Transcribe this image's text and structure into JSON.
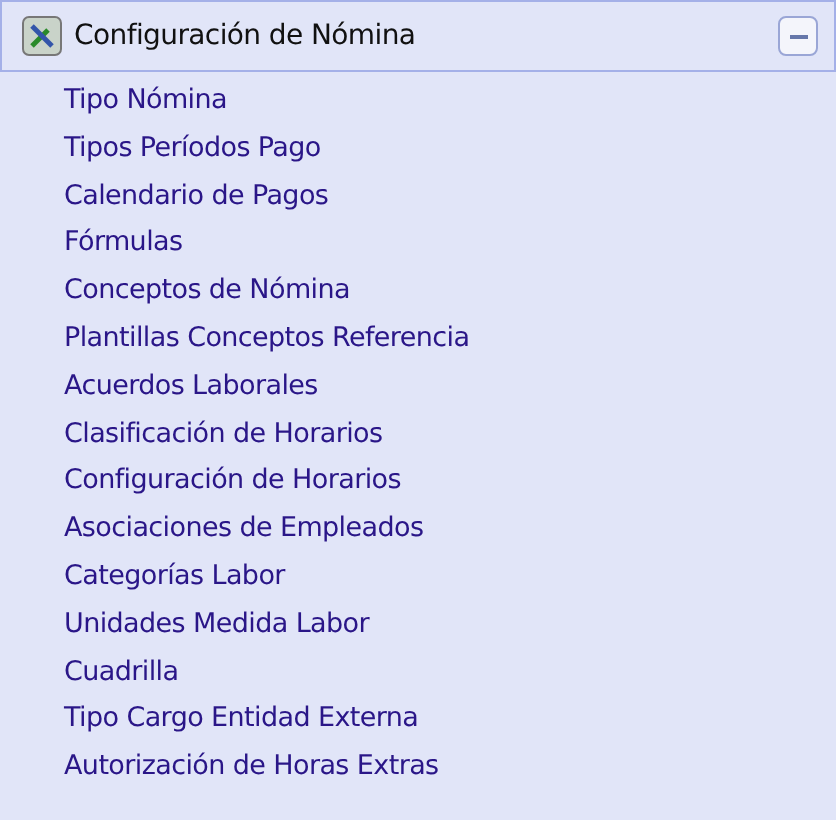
{
  "panel": {
    "title": "Configuración de Nómina",
    "expanded": true,
    "items": [
      {
        "label": "Tipo Nómina"
      },
      {
        "label": "Tipos Períodos Pago"
      },
      {
        "label": "Calendario de Pagos"
      },
      {
        "label": "Fórmulas"
      },
      {
        "label": "Conceptos de Nómina"
      },
      {
        "label": "Plantillas Conceptos Referencia"
      },
      {
        "label": "Acuerdos Laborales"
      },
      {
        "label": "Clasificación de Horarios"
      },
      {
        "label": "Configuración de Horarios"
      },
      {
        "label": "Asociaciones de Empleados"
      },
      {
        "label": "Categorías Labor"
      },
      {
        "label": "Unidades Medida Labor"
      },
      {
        "label": "Cuadrilla"
      },
      {
        "label": "Tipo Cargo Entidad Externa"
      },
      {
        "label": "Autorización de Horas Extras"
      }
    ]
  }
}
